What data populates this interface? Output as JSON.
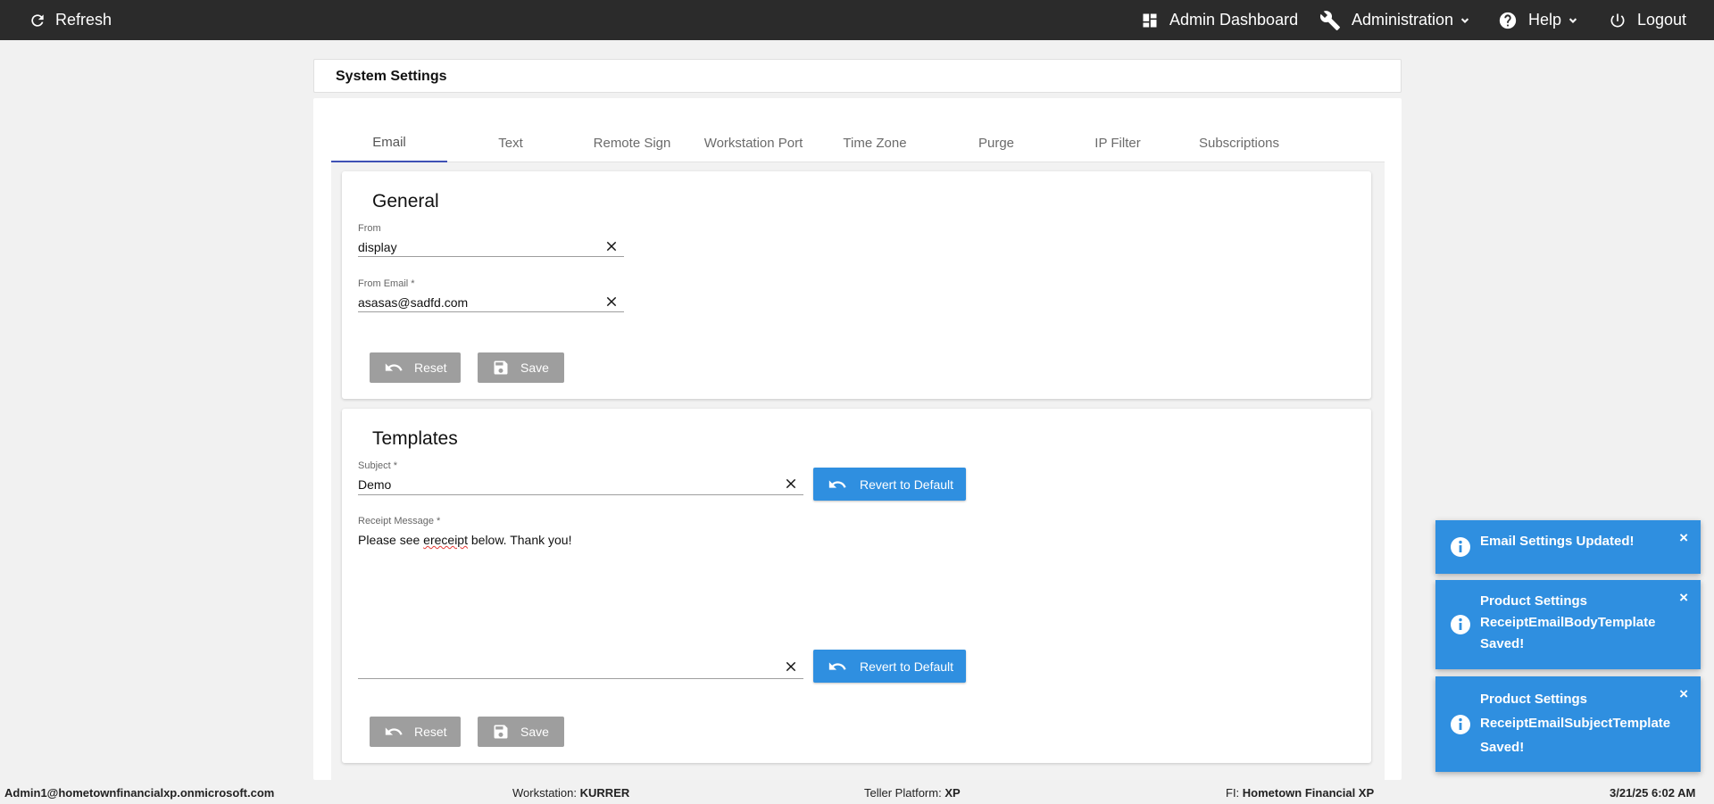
{
  "topbar": {
    "refresh_label": "Refresh",
    "dashboard_label": "Admin Dashboard",
    "administration_label": "Administration",
    "help_label": "Help",
    "logout_label": "Logout"
  },
  "page": {
    "title": "System Settings"
  },
  "tabs": [
    {
      "label": "Email",
      "active": true
    },
    {
      "label": "Text"
    },
    {
      "label": "Remote Sign"
    },
    {
      "label": "Workstation Port"
    },
    {
      "label": "Time Zone"
    },
    {
      "label": "Purge"
    },
    {
      "label": "IP Filter"
    },
    {
      "label": "Subscriptions"
    }
  ],
  "general": {
    "title": "General",
    "from_label": "From",
    "from_value": "display",
    "from_email_label": "From Email *",
    "from_email_value": "asasas@sadfd.com",
    "reset_label": "Reset",
    "save_label": "Save"
  },
  "templates": {
    "title": "Templates",
    "subject_label": "Subject *",
    "subject_value": "Demo",
    "revert_label": "Revert to Default",
    "receipt_label": "Receipt Message *",
    "receipt_before": "Please see ",
    "receipt_misspelled": "ereceipt",
    "receipt_after": " below. Thank you!",
    "revert2_label": "Revert to Default",
    "reset_label": "Reset",
    "save_label": "Save"
  },
  "toasts": [
    {
      "message": "Email Settings Updated!"
    },
    {
      "message": "Product Settings ReceiptEmailBodyTemplate Saved!"
    },
    {
      "message": "Product Settings ReceiptEmailSubjectTemplate Saved!"
    }
  ],
  "statusbar": {
    "user": "Admin1@hometownfinancialxp.onmicrosoft.com",
    "workstation_label": "Workstation:",
    "workstation_value": "KURRER",
    "platform_label": "Teller Platform:",
    "platform_value": "XP",
    "fi_label": "FI:",
    "fi_value": "Hometown Financial XP",
    "datetime": "3/21/25 6:02 AM"
  },
  "colors": {
    "navbar": "#2b2b2b",
    "accent_blue": "#2f8fe0",
    "tab_indicator": "#3f51b5",
    "disabled_button": "#9e9e9e"
  }
}
